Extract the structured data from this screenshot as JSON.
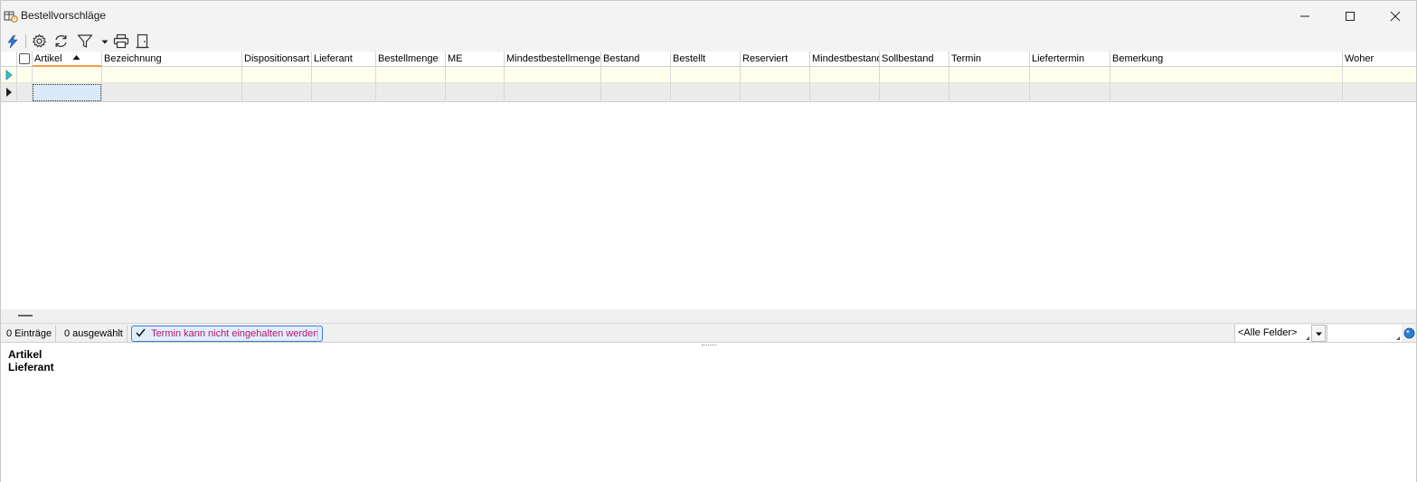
{
  "window": {
    "title": "Bestellvorschläge",
    "minimize_icon": "minimize-icon",
    "maximize_icon": "maximize-icon",
    "close_icon": "close-icon"
  },
  "toolbar": {
    "icons": [
      "lightning-icon",
      "gear-icon",
      "refresh-icon",
      "filter-icon",
      "chevron-down-icon",
      "printer-icon",
      "exit-door-icon"
    ]
  },
  "grid": {
    "columns": [
      "Artikel",
      "Bezeichnung",
      "Dispositionsart",
      "Lieferant",
      "Bestellmenge",
      "ME",
      "Mindestbestellmenge",
      "Bestand",
      "Bestellt",
      "Reserviert",
      "Mindestbestand",
      "Sollbestand",
      "Termin",
      "Liefertermin",
      "Bemerkung",
      "Woher"
    ],
    "sort_column": "Artikel",
    "sort_direction": "ascending"
  },
  "status": {
    "entries": "0 Einträge",
    "selected": "0 ausgewählt",
    "legend": "Termin kann nicht eingehalten werden",
    "search_field": "<Alle Felder>",
    "search_value": ""
  },
  "detail": {
    "labels": [
      "Artikel",
      "Lieferant"
    ]
  },
  "colors": {
    "accent_orange": "#f39c4a",
    "legend_text": "#b0186a",
    "filter_row": "#ffffee",
    "selected_cell": "#dbe9f9"
  }
}
